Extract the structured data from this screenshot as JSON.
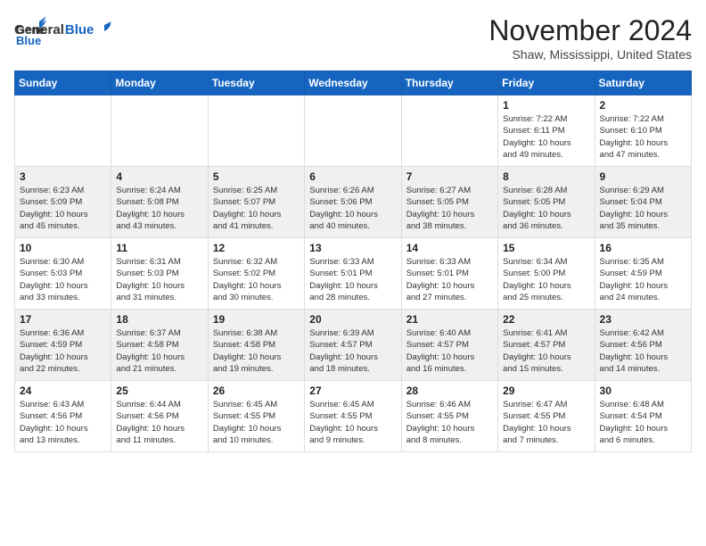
{
  "header": {
    "logo_general": "General",
    "logo_blue": "Blue",
    "month": "November 2024",
    "location": "Shaw, Mississippi, United States"
  },
  "days_of_week": [
    "Sunday",
    "Monday",
    "Tuesday",
    "Wednesday",
    "Thursday",
    "Friday",
    "Saturday"
  ],
  "weeks": [
    [
      {
        "day": "",
        "info": ""
      },
      {
        "day": "",
        "info": ""
      },
      {
        "day": "",
        "info": ""
      },
      {
        "day": "",
        "info": ""
      },
      {
        "day": "",
        "info": ""
      },
      {
        "day": "1",
        "info": "Sunrise: 7:22 AM\nSunset: 6:11 PM\nDaylight: 10 hours\nand 49 minutes."
      },
      {
        "day": "2",
        "info": "Sunrise: 7:22 AM\nSunset: 6:10 PM\nDaylight: 10 hours\nand 47 minutes."
      }
    ],
    [
      {
        "day": "3",
        "info": "Sunrise: 6:23 AM\nSunset: 5:09 PM\nDaylight: 10 hours\nand 45 minutes."
      },
      {
        "day": "4",
        "info": "Sunrise: 6:24 AM\nSunset: 5:08 PM\nDaylight: 10 hours\nand 43 minutes."
      },
      {
        "day": "5",
        "info": "Sunrise: 6:25 AM\nSunset: 5:07 PM\nDaylight: 10 hours\nand 41 minutes."
      },
      {
        "day": "6",
        "info": "Sunrise: 6:26 AM\nSunset: 5:06 PM\nDaylight: 10 hours\nand 40 minutes."
      },
      {
        "day": "7",
        "info": "Sunrise: 6:27 AM\nSunset: 5:05 PM\nDaylight: 10 hours\nand 38 minutes."
      },
      {
        "day": "8",
        "info": "Sunrise: 6:28 AM\nSunset: 5:05 PM\nDaylight: 10 hours\nand 36 minutes."
      },
      {
        "day": "9",
        "info": "Sunrise: 6:29 AM\nSunset: 5:04 PM\nDaylight: 10 hours\nand 35 minutes."
      }
    ],
    [
      {
        "day": "10",
        "info": "Sunrise: 6:30 AM\nSunset: 5:03 PM\nDaylight: 10 hours\nand 33 minutes."
      },
      {
        "day": "11",
        "info": "Sunrise: 6:31 AM\nSunset: 5:03 PM\nDaylight: 10 hours\nand 31 minutes."
      },
      {
        "day": "12",
        "info": "Sunrise: 6:32 AM\nSunset: 5:02 PM\nDaylight: 10 hours\nand 30 minutes."
      },
      {
        "day": "13",
        "info": "Sunrise: 6:33 AM\nSunset: 5:01 PM\nDaylight: 10 hours\nand 28 minutes."
      },
      {
        "day": "14",
        "info": "Sunrise: 6:33 AM\nSunset: 5:01 PM\nDaylight: 10 hours\nand 27 minutes."
      },
      {
        "day": "15",
        "info": "Sunrise: 6:34 AM\nSunset: 5:00 PM\nDaylight: 10 hours\nand 25 minutes."
      },
      {
        "day": "16",
        "info": "Sunrise: 6:35 AM\nSunset: 4:59 PM\nDaylight: 10 hours\nand 24 minutes."
      }
    ],
    [
      {
        "day": "17",
        "info": "Sunrise: 6:36 AM\nSunset: 4:59 PM\nDaylight: 10 hours\nand 22 minutes."
      },
      {
        "day": "18",
        "info": "Sunrise: 6:37 AM\nSunset: 4:58 PM\nDaylight: 10 hours\nand 21 minutes."
      },
      {
        "day": "19",
        "info": "Sunrise: 6:38 AM\nSunset: 4:58 PM\nDaylight: 10 hours\nand 19 minutes."
      },
      {
        "day": "20",
        "info": "Sunrise: 6:39 AM\nSunset: 4:57 PM\nDaylight: 10 hours\nand 18 minutes."
      },
      {
        "day": "21",
        "info": "Sunrise: 6:40 AM\nSunset: 4:57 PM\nDaylight: 10 hours\nand 16 minutes."
      },
      {
        "day": "22",
        "info": "Sunrise: 6:41 AM\nSunset: 4:57 PM\nDaylight: 10 hours\nand 15 minutes."
      },
      {
        "day": "23",
        "info": "Sunrise: 6:42 AM\nSunset: 4:56 PM\nDaylight: 10 hours\nand 14 minutes."
      }
    ],
    [
      {
        "day": "24",
        "info": "Sunrise: 6:43 AM\nSunset: 4:56 PM\nDaylight: 10 hours\nand 13 minutes."
      },
      {
        "day": "25",
        "info": "Sunrise: 6:44 AM\nSunset: 4:56 PM\nDaylight: 10 hours\nand 11 minutes."
      },
      {
        "day": "26",
        "info": "Sunrise: 6:45 AM\nSunset: 4:55 PM\nDaylight: 10 hours\nand 10 minutes."
      },
      {
        "day": "27",
        "info": "Sunrise: 6:45 AM\nSunset: 4:55 PM\nDaylight: 10 hours\nand 9 minutes."
      },
      {
        "day": "28",
        "info": "Sunrise: 6:46 AM\nSunset: 4:55 PM\nDaylight: 10 hours\nand 8 minutes."
      },
      {
        "day": "29",
        "info": "Sunrise: 6:47 AM\nSunset: 4:55 PM\nDaylight: 10 hours\nand 7 minutes."
      },
      {
        "day": "30",
        "info": "Sunrise: 6:48 AM\nSunset: 4:54 PM\nDaylight: 10 hours\nand 6 minutes."
      }
    ]
  ]
}
